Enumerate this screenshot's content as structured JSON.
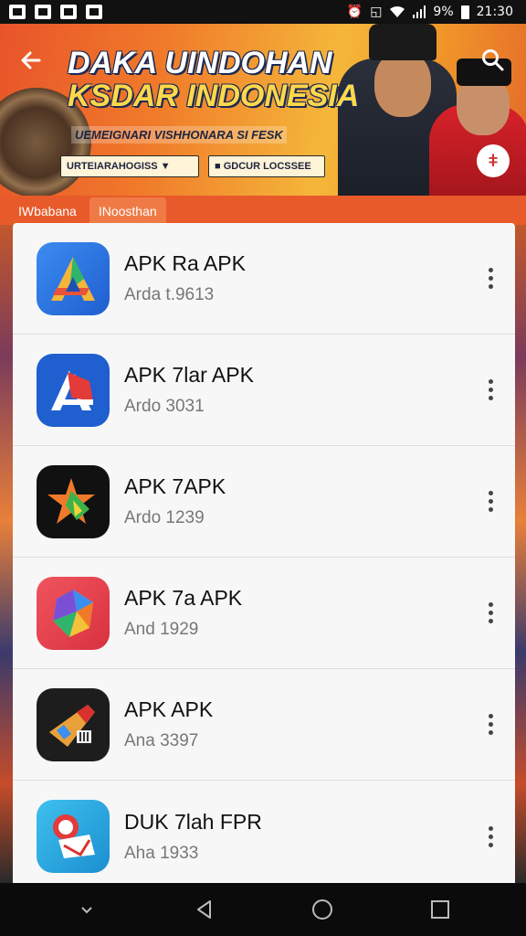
{
  "status_bar": {
    "battery_text": "9%",
    "time": "21:30"
  },
  "banner": {
    "title_line1": "DAKA UINDOHAN",
    "title_line2": "KSDAR INDONESIA",
    "subtitle": "UEMEIGNARI VISHHONARA SI FESK",
    "chip1": "URTEIARAHOGISS ▼",
    "chip2": "■ GDCUR LOCSSEE"
  },
  "tabs": [
    {
      "label": "IWbabana"
    },
    {
      "label": "INoosthan"
    }
  ],
  "apps": [
    {
      "name": "APK Ra APK",
      "subtitle": "Arda t.9613",
      "icon": "apk-a-icon",
      "color": "#2d6fd6"
    },
    {
      "name": "APK 7lar APK",
      "subtitle": "Ardo 3031",
      "icon": "apk-a-red-icon",
      "color": "#1f5fcf"
    },
    {
      "name": "APK 7APK",
      "subtitle": "Ardo 1239",
      "icon": "star-icon",
      "color": "#111111"
    },
    {
      "name": "APK 7a APK",
      "subtitle": "And 1929",
      "icon": "cube-icon",
      "color": "#e8434f"
    },
    {
      "name": "APK APK",
      "subtitle": "Ana 3397",
      "icon": "rocket-icon",
      "color": "#1d1d1d"
    },
    {
      "name": "DUK 7lah FPR",
      "subtitle": "Aha 1933",
      "icon": "badge-icon",
      "color": "#26a6e0"
    }
  ]
}
